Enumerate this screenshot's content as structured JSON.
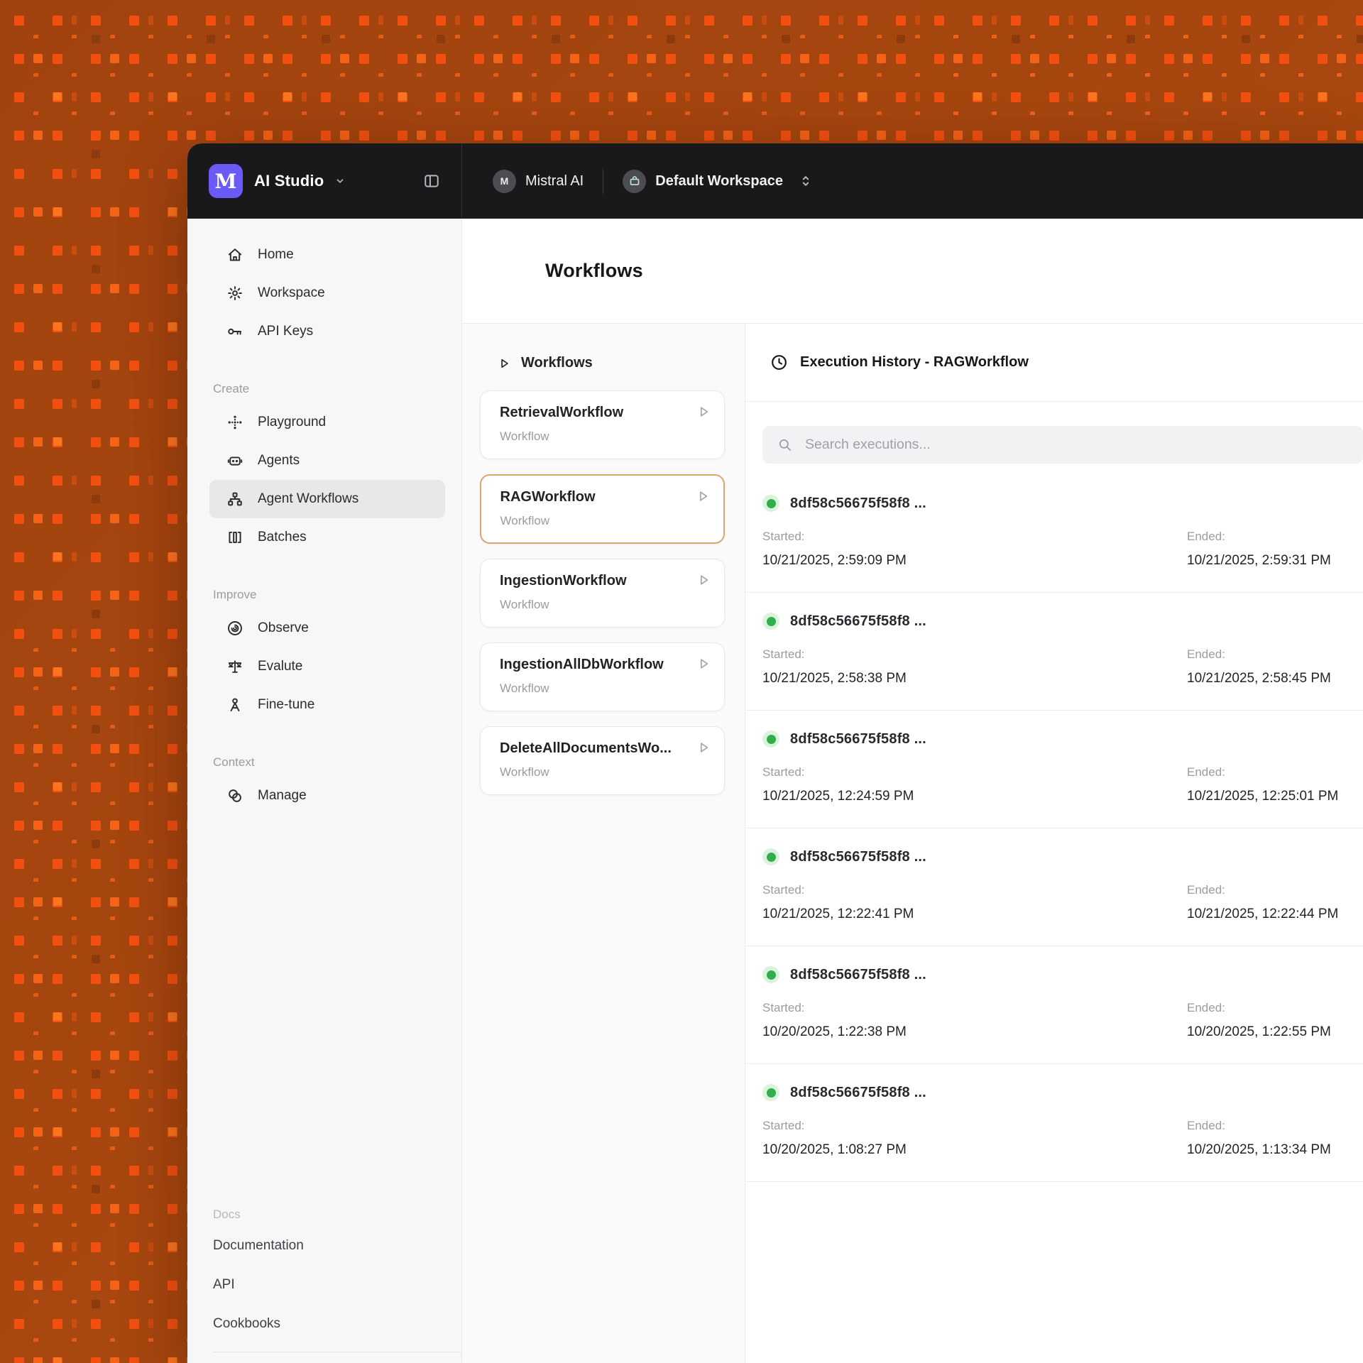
{
  "colors": {
    "header_bg": "#19191c",
    "logo_indigo": "#6a5bf7",
    "accent_orange": "#dda56c",
    "status_green": "#32ad4b",
    "bg_base": "#a8470f",
    "bg_square": "#f25010"
  },
  "header": {
    "app_title": "AI Studio",
    "logo_letter": "M",
    "org_avatar_letter": "M",
    "org_name": "Mistral AI",
    "workspace_name": "Default Workspace"
  },
  "sidebar": {
    "sections": [
      {
        "label": "",
        "items": [
          {
            "label": "Home",
            "icon": "#i-home"
          },
          {
            "label": "Workspace",
            "icon": "#i-gear"
          },
          {
            "label": "API Keys",
            "icon": "#i-key"
          }
        ]
      },
      {
        "label": "Create",
        "items": [
          {
            "label": "Playground",
            "icon": "#i-playground"
          },
          {
            "label": "Agents",
            "icon": "#i-robot"
          },
          {
            "label": "Agent Workflows",
            "icon": "#i-orgchart",
            "selected": true
          },
          {
            "label": "Batches",
            "icon": "#i-batches"
          }
        ]
      },
      {
        "label": "Improve",
        "items": [
          {
            "label": "Observe",
            "icon": "#i-observe"
          },
          {
            "label": "Evalute",
            "icon": "#i-scales"
          },
          {
            "label": "Fine-tune",
            "icon": "#i-finetune"
          }
        ]
      },
      {
        "label": "Context",
        "items": [
          {
            "label": "Manage",
            "icon": "#i-manage"
          }
        ]
      }
    ],
    "footer": {
      "label": "Docs",
      "links": [
        {
          "label": "Documentation"
        },
        {
          "label": "API"
        },
        {
          "label": "Cookbooks"
        }
      ]
    }
  },
  "main": {
    "page_title": "Workflows",
    "list": {
      "header": "Workflows",
      "items": [
        {
          "name": "RetrievalWorkflow",
          "type": "Workflow"
        },
        {
          "name": "RAGWorkflow",
          "type": "Workflow",
          "selected": true
        },
        {
          "name": "IngestionWorkflow",
          "type": "Workflow"
        },
        {
          "name": "IngestionAllDbWorkflow",
          "type": "Workflow"
        },
        {
          "name": "DeleteAllDocumentsWo...",
          "type": "Workflow"
        }
      ]
    },
    "history": {
      "title": "Execution History - RAGWorkflow",
      "search_placeholder": "Search executions...",
      "labels": {
        "started": "Started:",
        "ended": "Ended:"
      },
      "executions": [
        {
          "id": "8df58c56675f58f8 ...",
          "started": "10/21/2025, 2:59:09 PM",
          "ended": "10/21/2025, 2:59:31 PM",
          "status": "success"
        },
        {
          "id": "8df58c56675f58f8 ...",
          "started": "10/21/2025, 2:58:38 PM",
          "ended": "10/21/2025, 2:58:45 PM",
          "status": "success"
        },
        {
          "id": "8df58c56675f58f8 ...",
          "started": "10/21/2025, 12:24:59 PM",
          "ended": "10/21/2025, 12:25:01 PM",
          "status": "success"
        },
        {
          "id": "8df58c56675f58f8 ...",
          "started": "10/21/2025, 12:22:41 PM",
          "ended": "10/21/2025, 12:22:44 PM",
          "status": "success"
        },
        {
          "id": "8df58c56675f58f8 ...",
          "started": "10/20/2025, 1:22:38 PM",
          "ended": "10/20/2025, 1:22:55 PM",
          "status": "success"
        },
        {
          "id": "8df58c56675f58f8 ...",
          "started": "10/20/2025, 1:08:27 PM",
          "ended": "10/20/2025, 1:13:34 PM",
          "status": "success"
        }
      ]
    }
  }
}
